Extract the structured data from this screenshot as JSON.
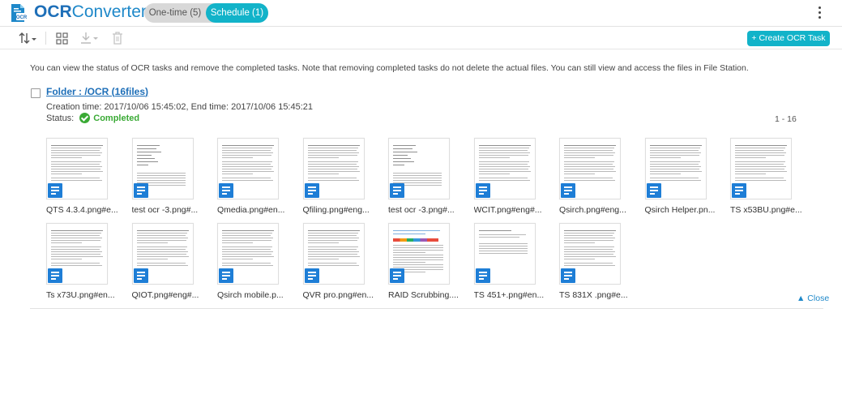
{
  "app": {
    "title_bold": "OCR",
    "title_rest": "Converter",
    "tabs": [
      {
        "label": "One-time (5)",
        "active": false
      },
      {
        "label": "Schedule (1)",
        "active": true
      }
    ],
    "menu_icon": "kebab-menu-icon"
  },
  "toolbar": {
    "sort_icon": "sort-icon",
    "view_icon": "grid-view-icon",
    "download_icon": "download-icon",
    "delete_icon": "trash-icon",
    "create_label": "+ Create OCR Task"
  },
  "info_text": "You can view the status of OCR tasks and remove the completed tasks. Note that removing completed tasks do not delete the actual files. You can still view and access the files in File Station.",
  "task": {
    "folder_label": "Folder : /OCR (",
    "folder_count": "16files",
    "folder_close": ")",
    "times": "Creation time: 2017/10/06 15:45:02, End time: 2017/10/06 15:45:21",
    "status_label": "Status:",
    "status_value": "Completed",
    "range": "1 - 16"
  },
  "files": [
    {
      "name": "QTS 4.3.4.png#e..."
    },
    {
      "name": "test ocr -3.png#..."
    },
    {
      "name": "Qmedia.png#en..."
    },
    {
      "name": "Qfiling.png#eng..."
    },
    {
      "name": "test ocr -3.png#..."
    },
    {
      "name": "WCIT.png#eng#..."
    },
    {
      "name": "Qsirch.png#eng..."
    },
    {
      "name": "Qsirch Helper.pn..."
    },
    {
      "name": "TS x53BU.png#e..."
    },
    {
      "name": "Ts x73U.png#en..."
    },
    {
      "name": "QIOT.png#eng#..."
    },
    {
      "name": "Qsirch mobile.p..."
    },
    {
      "name": "QVR pro.png#en..."
    },
    {
      "name": "RAID Scrubbing...."
    },
    {
      "name": "TS 451+.png#en..."
    },
    {
      "name": "TS 831X .png#e..."
    }
  ],
  "close_label": "▲ Close",
  "colors": {
    "accent": "#12b3c9",
    "brand": "#1e6fb8",
    "success": "#3aaa35",
    "file_icon": "#1e7ed6"
  }
}
